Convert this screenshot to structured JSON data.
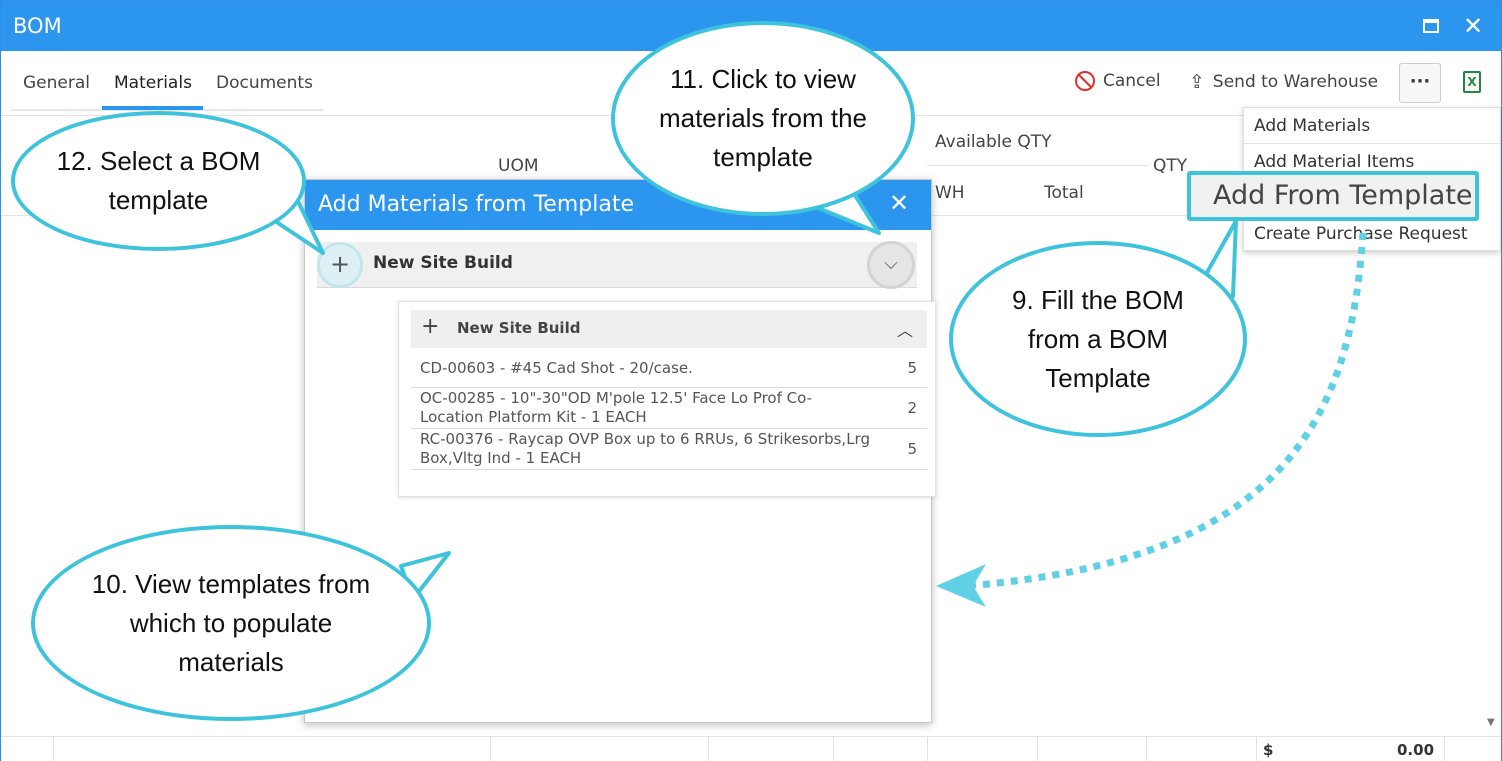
{
  "window": {
    "title": "BOM"
  },
  "tabs": [
    {
      "label": "General"
    },
    {
      "label": "Materials"
    },
    {
      "label": "Documents"
    }
  ],
  "toolbar": {
    "cancel_label": "Cancel",
    "send_label": "Send to Warehouse",
    "more_label": "···",
    "excel_label": "X"
  },
  "grid": {
    "uom": "UOM",
    "available_qty": "Available QTY",
    "wh": "WH",
    "total": "Total",
    "qty": "QTY"
  },
  "menu": {
    "items": [
      "Add Materials",
      "Add Material Items",
      "Add From Template",
      "Create Purchase Request"
    ]
  },
  "dialog": {
    "title": "Add Materials from Template",
    "close": "✕",
    "template_name": "New Site Build",
    "sub_title": "New Site Build",
    "materials": [
      {
        "desc": "CD-00603 - #45 Cad Shot - 20/case.",
        "qty": "5"
      },
      {
        "desc": "OC-00285 - 10\"-30\"OD M'pole 12.5' Face Lo Prof Co-Location Platform Kit - 1 EACH",
        "qty": "2"
      },
      {
        "desc": "RC-00376 - Raycap OVP Box up to 6 RRUs, 6 Strikesorbs,Lrg Box,Vltg Ind - 1 EACH",
        "qty": "5"
      }
    ]
  },
  "callouts": {
    "c9": "9. Fill the BOM from a BOM Template",
    "c10": "10. View templates from which to populate materials",
    "c11": "11. Click to view materials from the template",
    "c12": "12. Select a BOM template"
  },
  "footer": {
    "currency": "$",
    "total": "0.00"
  },
  "colors": {
    "accent": "#2c96ef",
    "callout": "#3ec3dc",
    "cancel": "#e0302a",
    "excel": "#1f8a3c"
  }
}
